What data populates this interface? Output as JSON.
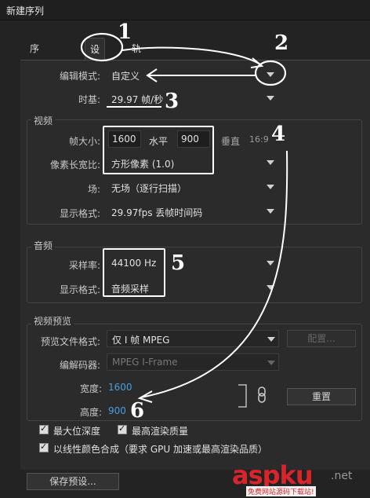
{
  "window": {
    "title": "新建序列"
  },
  "tabs": [
    {
      "label": "序列预设"
    },
    {
      "label": "设置"
    },
    {
      "label": "轨道"
    }
  ],
  "settings": {
    "edit_mode_label": "编辑模式:",
    "edit_mode_value": "自定义",
    "timebase_label": "时基:",
    "timebase_value": "29.97 帧/秒"
  },
  "video": {
    "group_title": "视频",
    "frame_size_label": "帧大小:",
    "frame_width": "1600",
    "horizontal_label": "水平",
    "frame_height": "900",
    "vertical_label": "垂直",
    "aspect": "16:9",
    "pixel_aspect_label": "像素长宽比:",
    "pixel_aspect_value": "方形像素 (1.0)",
    "fields_label": "场:",
    "fields_value": "无场（逐行扫描）",
    "display_format_label": "显示格式:",
    "display_format_value": "29.97fps 丢帧时间码"
  },
  "audio": {
    "group_title": "音频",
    "sample_rate_label": "采样率:",
    "sample_rate_value": "44100 Hz",
    "display_format_label": "显示格式:",
    "display_format_value": "音频采样"
  },
  "preview": {
    "group_title": "视频预览",
    "file_format_label": "预览文件格式:",
    "file_format_value": "仅 I 帧 MPEG",
    "configure_button": "配置...",
    "codec_label": "编解码器:",
    "codec_value": "MPEG I-Frame",
    "width_label": "宽度:",
    "width_value": "1600",
    "height_label": "高度:",
    "height_value": "900",
    "reset_button": "重置"
  },
  "options": {
    "max_depth": "最大位深度",
    "max_render": "最高渲染质量",
    "linear_color": "以线性颜色合成（要求 GPU 加速或最高渲染品质）"
  },
  "footer": {
    "save_preset_button": "保存预设..."
  },
  "annotations": [
    "1",
    "2",
    "3",
    "4",
    "5",
    "6"
  ],
  "watermark": {
    "main": "aspku",
    "suffix": ".net",
    "sub": "免费网站源码下载站!"
  }
}
